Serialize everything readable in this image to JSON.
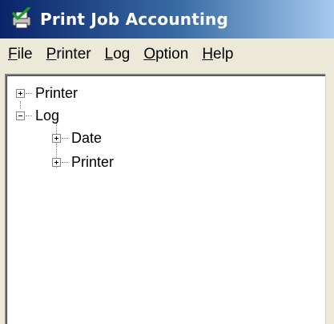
{
  "window": {
    "title": "Print Job Accounting",
    "app_icon": "printer-check-icon"
  },
  "menu": {
    "items": [
      {
        "label_accel": "F",
        "label_rest": "ile"
      },
      {
        "label_accel": "P",
        "label_rest": "rinter"
      },
      {
        "label_accel": "L",
        "label_rest": "og"
      },
      {
        "label_accel": "O",
        "label_rest": "ption"
      },
      {
        "label_accel": "H",
        "label_rest": "elp"
      }
    ]
  },
  "tree": {
    "nodes": [
      {
        "label": "Printer",
        "state": "collapsed",
        "level": 0
      },
      {
        "label": "Log",
        "state": "expanded",
        "level": 0
      },
      {
        "label": "Date",
        "state": "collapsed",
        "level": 1
      },
      {
        "label": "Printer",
        "state": "collapsed",
        "level": 1
      }
    ]
  }
}
